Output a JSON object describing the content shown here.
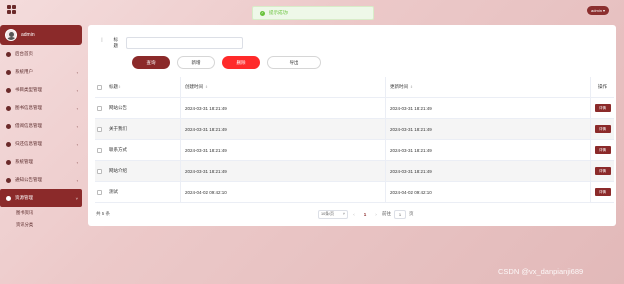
{
  "toast": {
    "message": "提示成功!"
  },
  "header": {
    "user": "admin"
  },
  "sidebar": {
    "user_name": "admin",
    "items": [
      {
        "label": "后台首页",
        "icon": "home-icon",
        "chevron": ""
      },
      {
        "label": "系统用户",
        "icon": "user-icon",
        "chevron": "‹"
      },
      {
        "label": "书目类型管理",
        "icon": "folder-icon",
        "chevron": "‹"
      },
      {
        "label": "图书信息管理",
        "icon": "book-icon",
        "chevron": "‹"
      },
      {
        "label": "借阅信息管理",
        "icon": "list-icon",
        "chevron": "‹"
      },
      {
        "label": "归还信息管理",
        "icon": "return-icon",
        "chevron": "‹"
      },
      {
        "label": "系统管理",
        "icon": "gear-icon",
        "chevron": "‹"
      },
      {
        "label": "通知公告管理",
        "icon": "bell-icon",
        "chevron": "‹"
      },
      {
        "label": "资源管理",
        "icon": "resource-icon",
        "chevron": "˅"
      }
    ],
    "sub_items": [
      "图书资讯",
      "资讯分类"
    ]
  },
  "search": {
    "label": "标题",
    "value": "",
    "placeholder": ""
  },
  "buttons": {
    "query": "查询",
    "add": "新增",
    "delete": "删除",
    "export": "导出"
  },
  "table": {
    "headers": {
      "title": "标题",
      "created": "创建时间",
      "updated": "更新时间",
      "action": "操作"
    },
    "sort_icon": "⇕",
    "detail_label": "详情",
    "rows": [
      {
        "title": "网站公告",
        "created": "2024-03-31 18:21:49",
        "updated": "2024-03-31 18:21:49"
      },
      {
        "title": "关于我们",
        "created": "2024-03-31 18:21:49",
        "updated": "2024-03-31 18:21:49"
      },
      {
        "title": "联系方式",
        "created": "2024-03-31 18:21:49",
        "updated": "2024-03-31 18:21:49"
      },
      {
        "title": "网站介绍",
        "created": "2024-03-31 18:21:49",
        "updated": "2024-03-31 18:21:49"
      },
      {
        "title": "测试",
        "created": "2024-04-02 09:42:10",
        "updated": "2024-04-02 09:42:10"
      }
    ]
  },
  "pagination": {
    "total": "共 5 条",
    "page_size": "10条/页",
    "prev": "‹",
    "current": "1",
    "next": "›",
    "goto_prefix": "前往",
    "goto_value": "1",
    "goto_suffix": "页"
  },
  "watermark": "CSDN @vx_danpianji689"
}
